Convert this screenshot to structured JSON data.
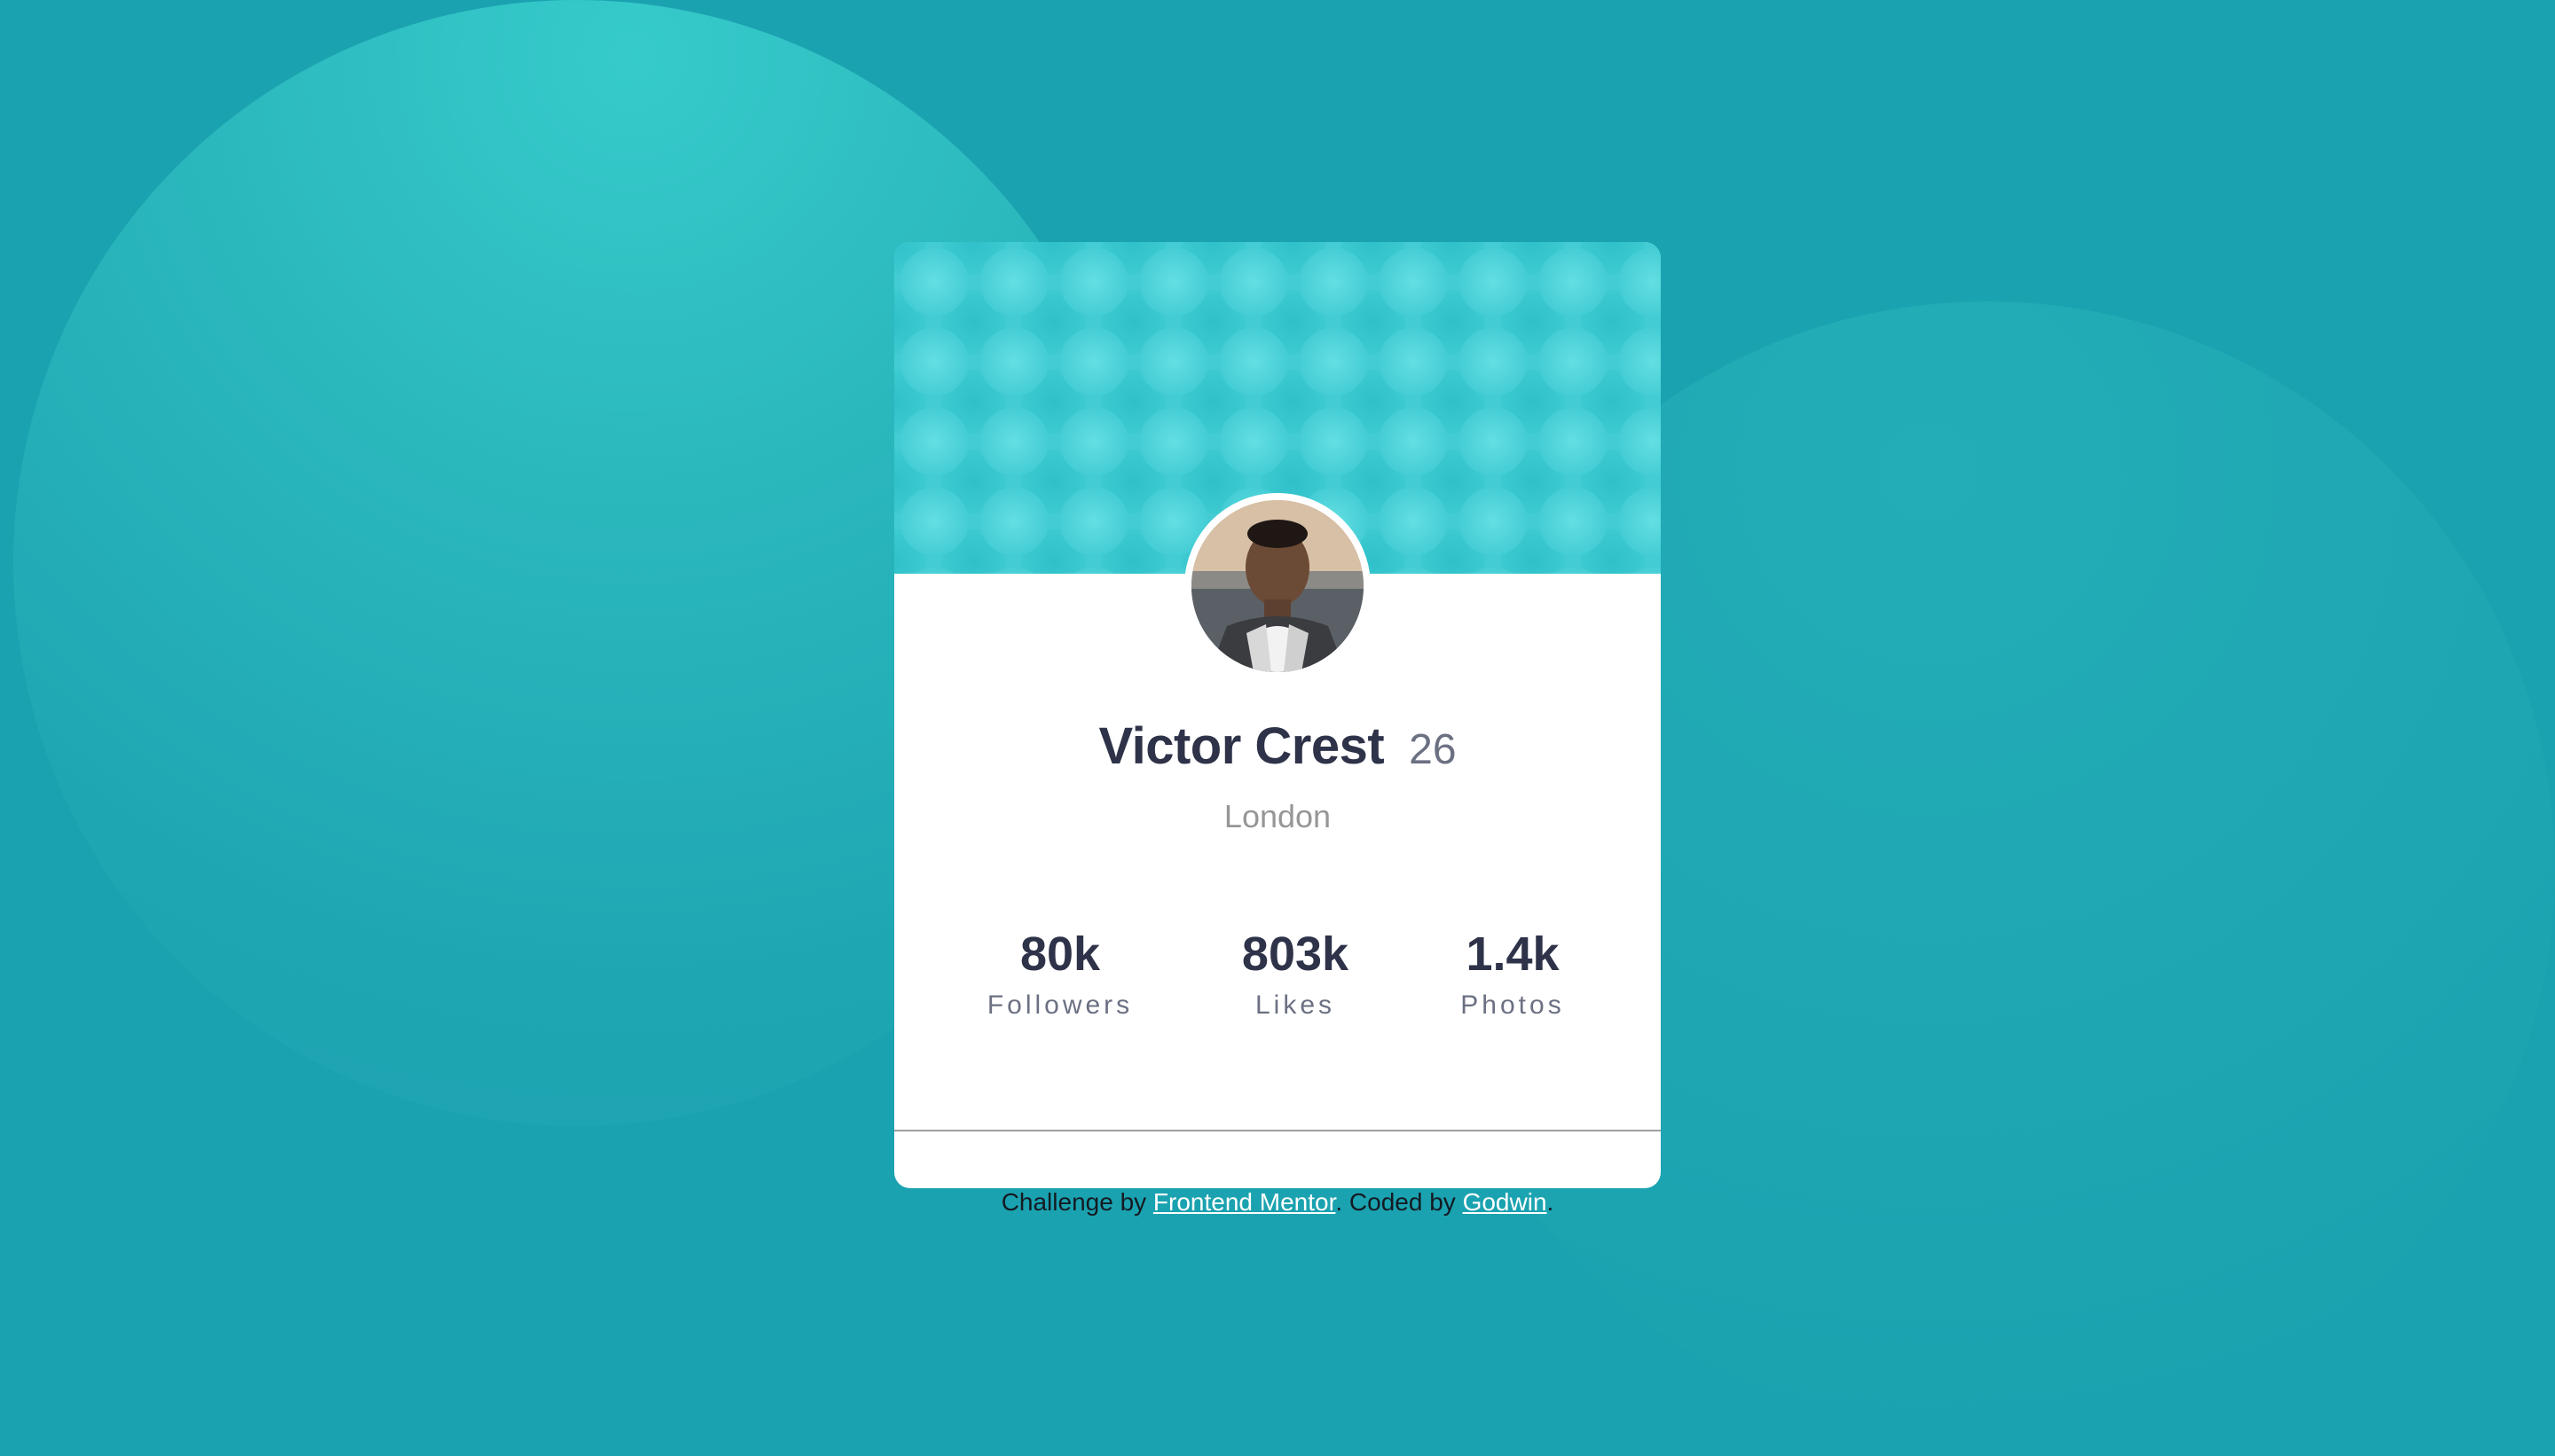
{
  "profile": {
    "name": "Victor Crest",
    "age": "26",
    "location": "London"
  },
  "stats": [
    {
      "value": "80k",
      "label": "Followers"
    },
    {
      "value": "803k",
      "label": "Likes"
    },
    {
      "value": "1.4k",
      "label": "Photos"
    }
  ],
  "attribution": {
    "prefix": "Challenge by ",
    "link1": "Frontend Mentor",
    "middle": ". Coded by ",
    "link2": "Godwin",
    "suffix": "."
  },
  "colors": {
    "background": "#1ba2b0",
    "header_pattern": "#44ccd4",
    "heading_text": "#2e3349",
    "muted_text": "#6b7082",
    "location_text": "#969696",
    "card": "#ffffff"
  }
}
